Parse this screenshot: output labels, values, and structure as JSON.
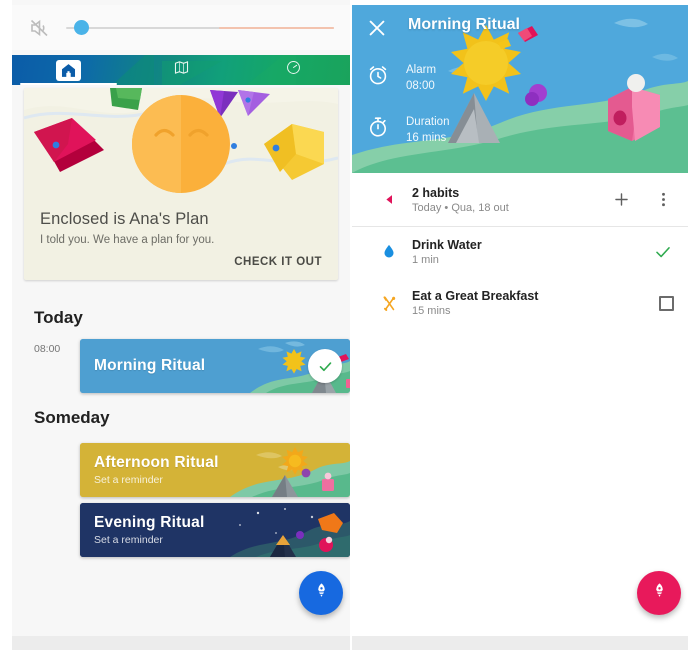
{
  "left_panel": {
    "volume": {
      "icon": "mute-speaker-icon",
      "value_percent": 3,
      "label": ""
    },
    "tabs": [
      {
        "id": "home",
        "icon": "home-icon",
        "selected": true
      },
      {
        "id": "map",
        "icon": "map-icon",
        "selected": false
      },
      {
        "id": "dashboard",
        "icon": "gauge-icon",
        "selected": false
      }
    ],
    "promo_card": {
      "title": "Enclosed is Ana's Plan",
      "subtitle": "I told you. We have a plan for you.",
      "action_label": "CHECK IT OUT",
      "art_icon": "sleeping-sun-face-illustration"
    },
    "sections": [
      {
        "title": "Today",
        "items": [
          {
            "time": "08:00",
            "name": "Morning Ritual",
            "subtitle": "",
            "completed": true,
            "theme": "#4e9fd1"
          }
        ]
      },
      {
        "title": "Someday",
        "items": [
          {
            "time": "",
            "name": "Afternoon Ritual",
            "subtitle": "Set a reminder",
            "completed": false,
            "theme": "#d4b337"
          },
          {
            "time": "",
            "name": "Evening Ritual",
            "subtitle": "Set a reminder",
            "completed": false,
            "theme": "#1f3465"
          }
        ]
      }
    ],
    "fab": {
      "icon": "rocket-icon",
      "color": "#1769e0"
    }
  },
  "right_panel": {
    "header": {
      "close_icon": "close-icon",
      "title": "Morning Ritual",
      "meta": [
        {
          "icon": "alarm-clock-icon",
          "key": "Alarm",
          "value": "08:00"
        },
        {
          "icon": "stopwatch-icon",
          "key": "Duration",
          "value": "16 mins"
        }
      ]
    },
    "habits_header": {
      "collapse_icon": "triangle-left-icon",
      "title": "2 habits",
      "subtitle": "Today • Qua, 18 out",
      "add_label": "+",
      "menu_icon": "overflow-menu-icon"
    },
    "habits": [
      {
        "icon": "water-drop-icon",
        "icon_color": "#1a8fe0",
        "name": "Drink Water",
        "duration": "1 min",
        "state": "done"
      },
      {
        "icon": "fork-spoon-icon",
        "icon_color": "#f5a623",
        "name": "Eat a Great Breakfast",
        "duration": "15 mins",
        "state": "unchecked"
      }
    ],
    "fab": {
      "icon": "rocket-icon",
      "color": "#e8195b"
    }
  }
}
